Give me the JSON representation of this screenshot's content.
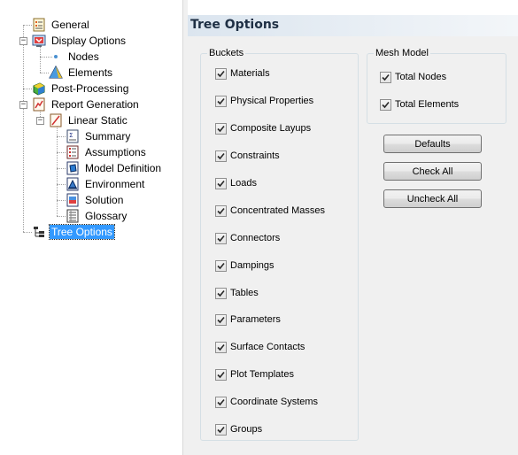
{
  "tree": {
    "items": [
      {
        "label": "General",
        "icon": "general-icon"
      },
      {
        "label": "Display Options",
        "icon": "display-options-icon"
      },
      {
        "label": "Nodes",
        "icon": "nodes-icon"
      },
      {
        "label": "Elements",
        "icon": "elements-icon"
      },
      {
        "label": "Post-Processing",
        "icon": "post-processing-icon"
      },
      {
        "label": "Report Generation",
        "icon": "report-generation-icon"
      },
      {
        "label": "Linear Static",
        "icon": "linear-static-icon"
      },
      {
        "label": "Summary",
        "icon": "summary-icon"
      },
      {
        "label": "Assumptions",
        "icon": "assumptions-icon"
      },
      {
        "label": "Model Definition",
        "icon": "model-definition-icon"
      },
      {
        "label": "Environment",
        "icon": "environment-icon"
      },
      {
        "label": "Solution",
        "icon": "solution-icon"
      },
      {
        "label": "Glossary",
        "icon": "glossary-icon"
      },
      {
        "label": "Tree Options",
        "icon": "tree-options-icon",
        "selected": true
      }
    ]
  },
  "panel": {
    "title": "Tree Options",
    "buckets": {
      "title": "Buckets",
      "items": [
        {
          "label": "Materials",
          "checked": true
        },
        {
          "label": "Physical Properties",
          "checked": true
        },
        {
          "label": "Composite Layups",
          "checked": true
        },
        {
          "label": "Constraints",
          "checked": true
        },
        {
          "label": "Loads",
          "checked": true
        },
        {
          "label": "Concentrated Masses",
          "checked": true
        },
        {
          "label": "Connectors",
          "checked": true
        },
        {
          "label": "Dampings",
          "checked": true
        },
        {
          "label": "Tables",
          "checked": true
        },
        {
          "label": "Parameters",
          "checked": true
        },
        {
          "label": "Surface Contacts",
          "checked": true
        },
        {
          "label": "Plot Templates",
          "checked": true
        },
        {
          "label": "Coordinate Systems",
          "checked": true
        },
        {
          "label": "Groups",
          "checked": true
        }
      ]
    },
    "mesh_model": {
      "title": "Mesh Model",
      "items": [
        {
          "label": "Total Nodes",
          "checked": true
        },
        {
          "label": "Total Elements",
          "checked": true
        }
      ]
    },
    "buttons": {
      "defaults": "Defaults",
      "check_all": "Check All",
      "uncheck_all": "Uncheck All"
    }
  },
  "colors": {
    "selection": "#3399ff",
    "header_gradient_start": "#dbe5ef",
    "header_title": "#1e2f44",
    "groupbox_border": "#d5dfe5"
  }
}
